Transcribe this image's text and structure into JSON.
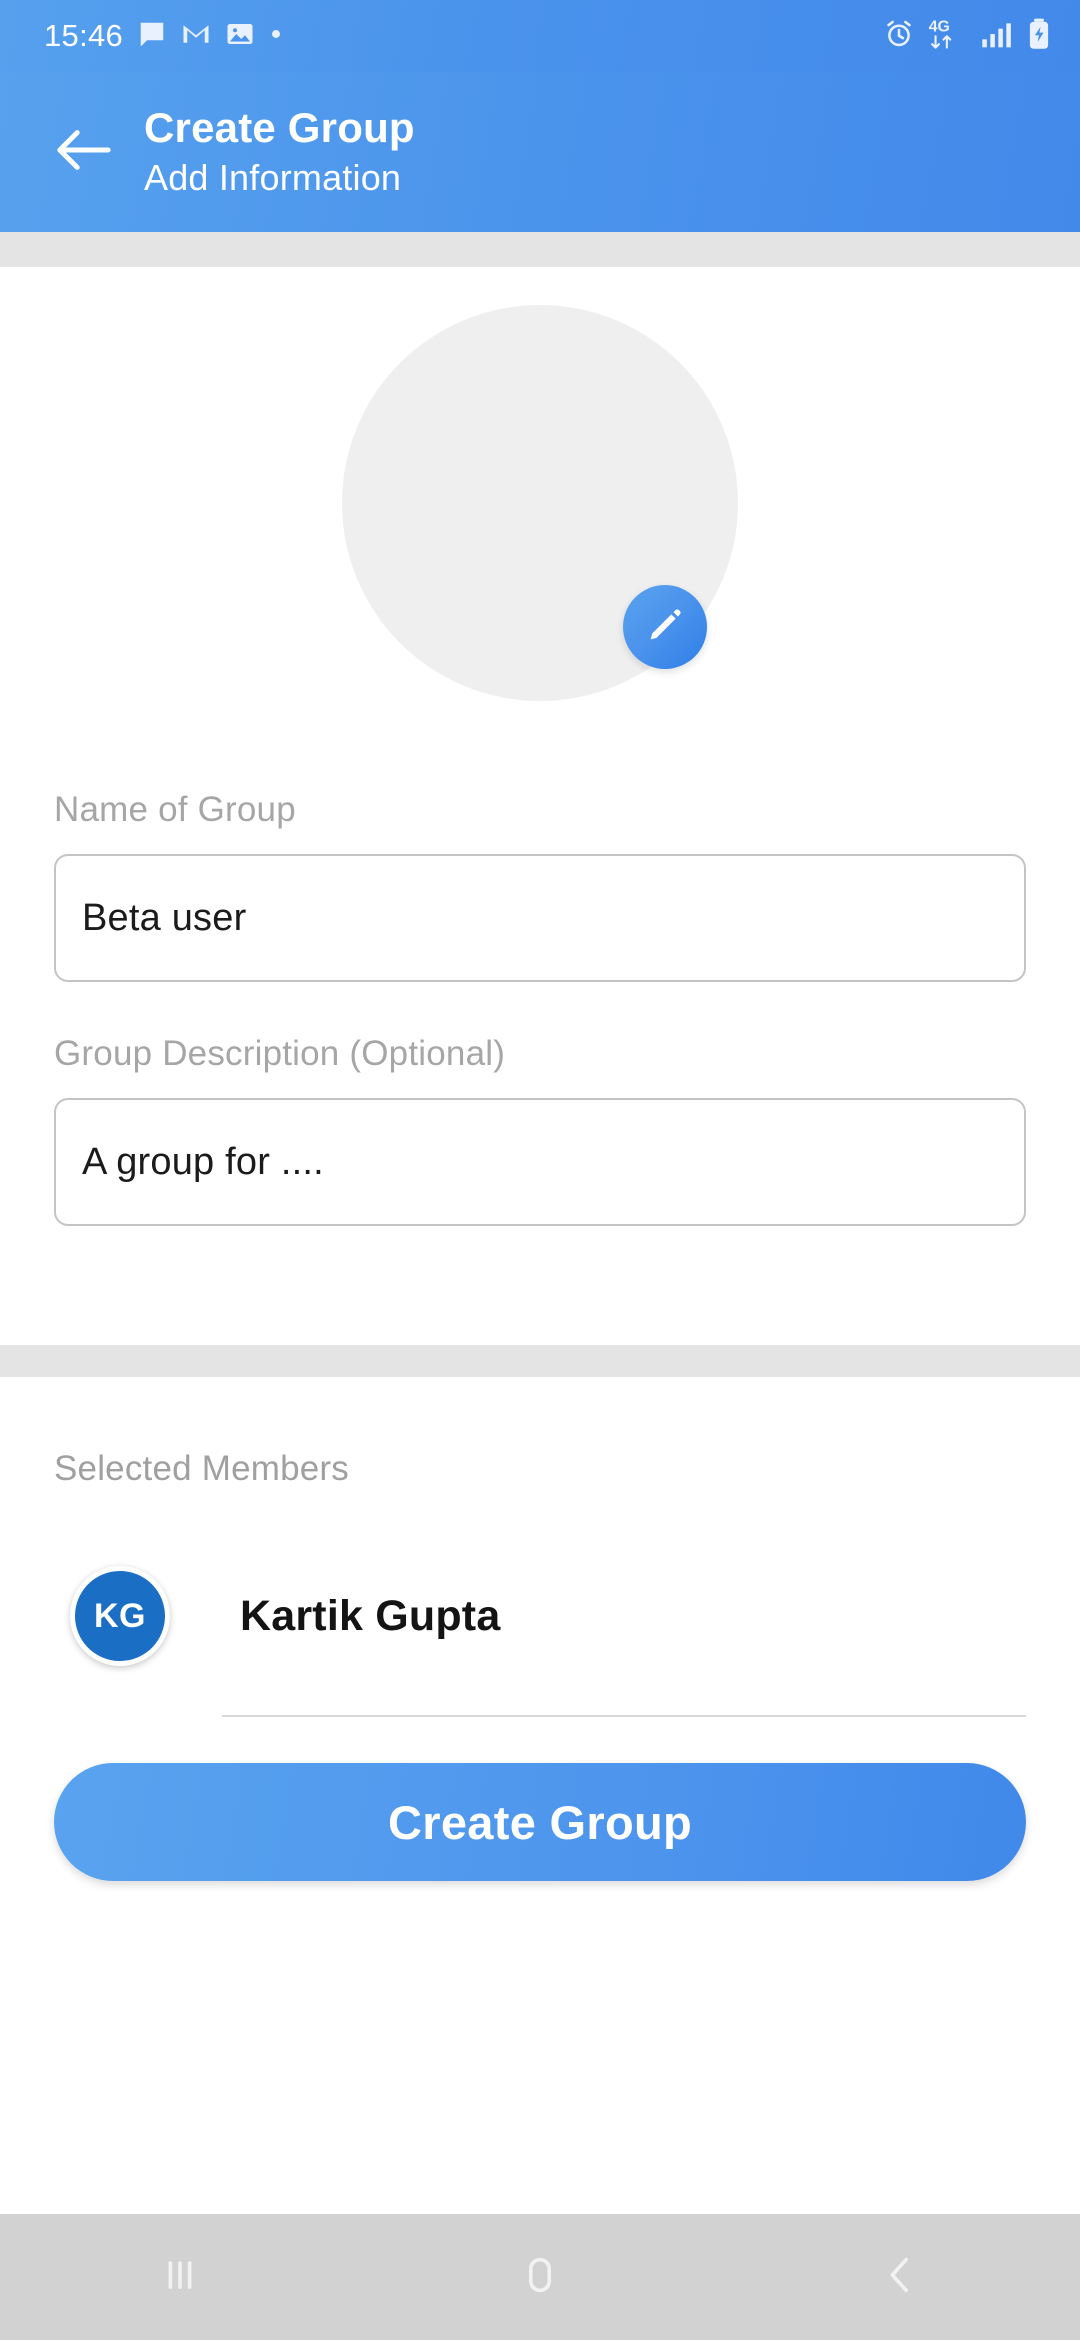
{
  "status_bar": {
    "clock": "15:46",
    "left_icons": [
      "message-icon",
      "gmail-icon",
      "photos-icon",
      "dot-icon"
    ],
    "right_icons": [
      "alarm-icon",
      "network-4g-icon",
      "signal-icon",
      "battery-charging-icon"
    ],
    "network_label": "4G"
  },
  "app_bar": {
    "back_icon": "back-arrow-icon",
    "title": "Create Group",
    "subtitle": "Add Information"
  },
  "avatar": {
    "placeholder_label": "group-photo-placeholder",
    "edit_icon": "pencil-icon"
  },
  "form": {
    "name_field": {
      "label": "Name of Group",
      "value": "Beta user",
      "placeholder": "Name of Group"
    },
    "description_field": {
      "label": "Group Description (Optional)",
      "value": "A group for ....",
      "placeholder": "Group Description (Optional)"
    }
  },
  "members": {
    "section_label": "Selected Members",
    "list": [
      {
        "initials": "KG",
        "name": "Kartik Gupta"
      }
    ]
  },
  "actions": {
    "create_group": "Create Group"
  },
  "nav_bar": {
    "recents": "recents-icon",
    "home": "home-icon",
    "back": "back-icon"
  },
  "colors": {
    "header_blue": "#4a93ec",
    "accent_blue": "#4389ea",
    "avatar_blue": "#1a6fc4",
    "placeholder_gray": "#efefef",
    "divider_gray": "#e4e4e4",
    "label_gray": "#a6a6a6",
    "nav_gray": "#d2d2d2"
  }
}
